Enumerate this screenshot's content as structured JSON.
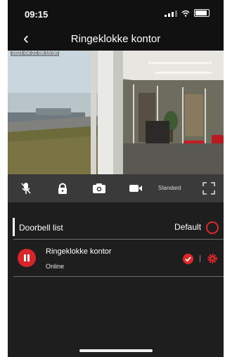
{
  "status_bar": {
    "time": "09:15"
  },
  "nav": {
    "back_icon": "chevron-left-icon",
    "title": "Ringeklokke kontor"
  },
  "video": {
    "timestamp": "2021-04-21 09:15:00"
  },
  "controls": {
    "icons": [
      "microphone-muted-icon",
      "lock-icon",
      "camera-icon",
      "video-record-icon",
      "fullscreen-icon"
    ],
    "quality_label": "Standard"
  },
  "doorbell_list": {
    "title": "Doorbell list",
    "default_label": "Default"
  },
  "devices": [
    {
      "name": "Ringeklokke kontor",
      "status": "Online"
    }
  ],
  "colors": {
    "accent": "#e02828",
    "background": "#1e1e1e",
    "control_bar": "#3a3a3a"
  }
}
